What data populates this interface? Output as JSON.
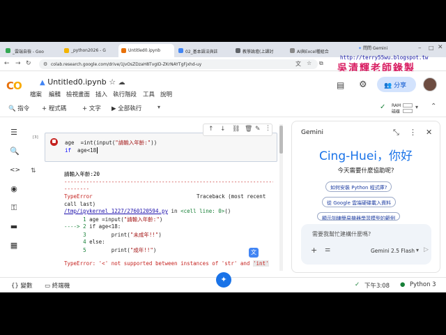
{
  "browser": {
    "tabs": [
      {
        "label": "_雲端自檢 - Goo"
      },
      {
        "label": "_python2026 - G"
      },
      {
        "label": "Untitled0.ipynb"
      },
      {
        "label": "02_基本語法與註"
      },
      {
        "label": "教學論壇(上課討"
      },
      {
        "label": "AI與Excel種組合"
      }
    ],
    "gemini_chip": "問問 Gemini",
    "url": "colab.research.google.com/drive/1JvOsZDzaH8TvgID-ZKrNAYTgFjxhd-uy"
  },
  "watermark": {
    "url": "http://terry55wu.blogspot.tw",
    "name": "吳清輝老師錄製"
  },
  "colab": {
    "logo": "CO",
    "filename": "Untitled0.ipynb",
    "menu": [
      "檔案",
      "編輯",
      "檢視畫面",
      "插入",
      "執行階段",
      "工具",
      "說明"
    ],
    "share_label": "分享",
    "toolbar": {
      "commands": "指令",
      "code": "+ 程式碼",
      "text": "+ 文字",
      "run_all": "全部執行",
      "ram": "RAM",
      "disk": "磁碟"
    }
  },
  "cell": {
    "exec_count": "[3]",
    "line1a": "age  =int(input(",
    "line1b": "\"請輸入年齡:\"",
    "line1c": "))",
    "line2a": "if",
    "line2b": "  age<18"
  },
  "output": {
    "prompt": "請輸入年齡:20",
    "dashes": "---------------------------------------------------------------------------",
    "dashes2": "--------",
    "err_type": "TypeError",
    "traceback_label": "Traceback (most recent",
    "traceback_cont": "call last)",
    "file_link": "/tmp/ipykernel_1227/2760120594.py",
    "in_text": " in ",
    "cell_line": "<cell line: 0>",
    "parens": "()",
    "lines": [
      {
        "num": "      1",
        "code": " age =input(",
        "str": "\"請輸入年齡:\"",
        "tail": ")"
      },
      {
        "num": "----> 2",
        "code": " if age<18:",
        "str": "",
        "tail": ""
      },
      {
        "num": "      3",
        "code": "        print(",
        "str": "\"未成年!!\"",
        "tail": ")"
      },
      {
        "num": "      4",
        "code": " else:",
        "str": "",
        "tail": ""
      },
      {
        "num": "      5",
        "code": "        print(",
        "str": "\"成年!!\"",
        "tail": ")"
      }
    ],
    "final_error": "TypeError: '<' not supported between instances of 'str' and ",
    "final_int": "'int'"
  },
  "gemini": {
    "title": "Gemini",
    "greeting": "Cing-Huei，你好",
    "question": "今天需要什麼協助呢?",
    "suggestions": [
      "如何安裝 Python 程式庫?",
      "從 Google 雲端硬碟載入資料",
      "顯示訓練簡易機器學習模型的範例"
    ],
    "input_placeholder": "需要我幫忙建構什麼嗎?",
    "model": "Gemini 2.5 Flash"
  },
  "status": {
    "variables": "變數",
    "terminal": "終端機",
    "time": "下午3:08",
    "runtime": "Python 3"
  },
  "colors": {
    "accent": "#1a73e8",
    "error": "#c5221f",
    "string": "#a31515",
    "link": "#1a0dab"
  }
}
